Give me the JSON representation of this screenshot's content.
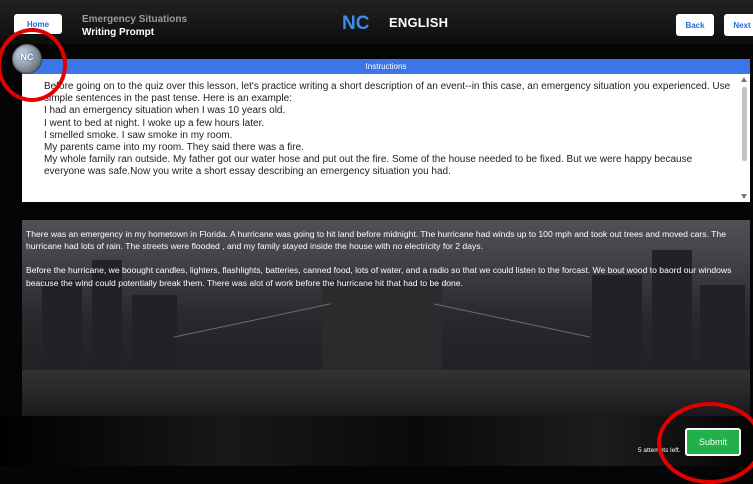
{
  "header": {
    "home_label": "Home",
    "crumb_title": "Emergency Situations",
    "crumb_subtitle": "Writing Prompt",
    "brand_logo": "NC",
    "brand_text": "ENGLISH",
    "back_label": "Back",
    "next_label": "Next"
  },
  "avatar": {
    "label": "NC"
  },
  "instructions": {
    "heading": "Instructions",
    "lines": [
      "Before going on to the quiz over this lesson, let's practice writing a short description of an event--in this case, an emergency situation you experienced. Use simple sentences in the past tense. Here is an example:",
      "I had an emergency situation when I was 10 years old.",
      "I went to bed at night. I woke up a few hours later.",
      "I smelled smoke. I saw smoke in my room.",
      "My parents came into my room. They said there was a fire.",
      "My whole family ran outside. My father got our water hose and put out the fire. Some of the house needed to be fixed. But we were happy because everyone was safe.Now you write a short essay describing an emergency situation you had."
    ]
  },
  "essay": {
    "paragraphs": [
      "There was an emergency in my hometown in Florida. A hurricane was going to hit land before midnight. The hurricane had winds up to 100 mph and took out trees and moved cars. The hurricane had lots of rain. The streets were flooded , and my family stayed inside the house with no electricity for 2 days.",
      "Before the hurricane, we boought candles, lighters, flashlights, batteries, canned food, lots of water, and a radio so that we could listen to the forcast. We bout wood to baord our windows beacuse the wind could potentially break them. There was alot of work before the hurricane hit that had to be done."
    ]
  },
  "footer": {
    "attempts": "5 attempts left.",
    "submit_label": "Submit"
  },
  "colors": {
    "accent_blue": "#3b75e8",
    "submit_green": "#22b04a",
    "highlight_red": "#e30000"
  }
}
